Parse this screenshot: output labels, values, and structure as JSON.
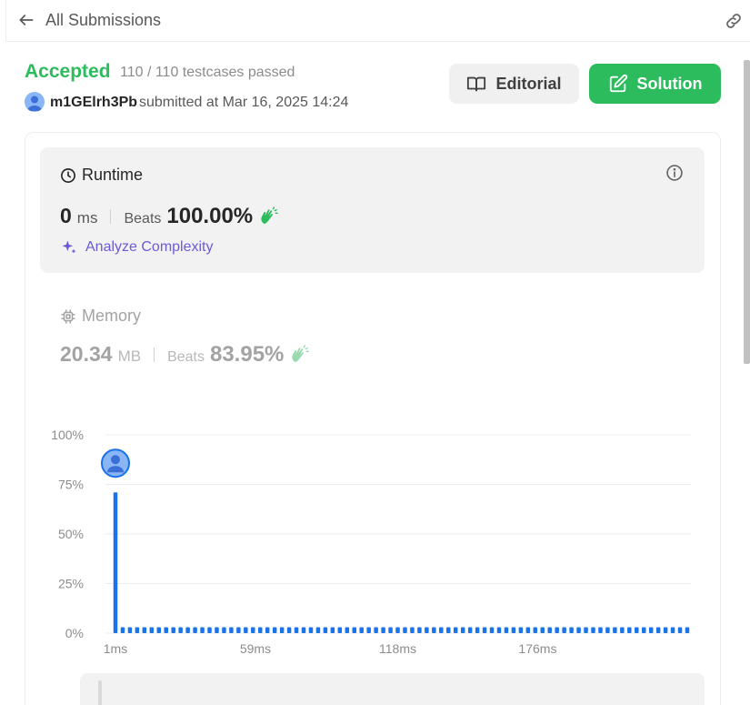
{
  "header": {
    "back_label": "All Submissions"
  },
  "submission": {
    "status": "Accepted",
    "testcases": "110 / 110 testcases passed",
    "username": "m1GElrh3Pb",
    "submitted_at": "submitted at Mar 16, 2025 14:24"
  },
  "buttons": {
    "editorial": "Editorial",
    "solution": "Solution"
  },
  "runtime": {
    "title": "Runtime",
    "value": "0",
    "unit": "ms",
    "beats_label": "Beats",
    "beats_pct": "100.00%",
    "analyze_label": "Analyze Complexity"
  },
  "memory": {
    "title": "Memory",
    "value": "20.34",
    "unit": "MB",
    "beats_label": "Beats",
    "beats_pct": "83.95%"
  },
  "colors": {
    "accent_green": "#2cbb5d",
    "bar_blue": "#1a73e8",
    "analyze_purple": "#6b5bd6"
  },
  "chart_data": {
    "type": "bar",
    "ylim": [
      0,
      100
    ],
    "yticks": [
      "100%",
      "75%",
      "50%",
      "25%",
      "0%"
    ],
    "xticks": [
      "1ms",
      "59ms",
      "118ms",
      "176ms"
    ],
    "x_start_ms": 1,
    "x_step_ms": 3,
    "values": [
      71,
      3,
      3,
      3,
      3,
      3,
      3,
      3,
      3,
      3,
      3,
      3,
      3,
      3,
      3,
      3,
      3,
      3,
      3,
      3,
      3,
      3,
      3,
      3,
      3,
      3,
      3,
      3,
      3,
      3,
      3,
      3,
      3,
      3,
      3,
      3,
      3,
      3,
      3,
      3,
      3,
      3,
      3,
      3,
      3,
      3,
      3,
      3,
      3,
      3,
      3,
      3,
      3,
      3,
      3,
      3,
      3,
      3,
      3,
      3,
      3,
      3,
      3,
      3,
      3,
      3,
      3,
      3,
      3,
      3,
      3,
      3,
      3,
      3,
      3,
      3,
      3,
      3,
      3,
      3
    ],
    "highlight_index": 0,
    "grid": true
  }
}
